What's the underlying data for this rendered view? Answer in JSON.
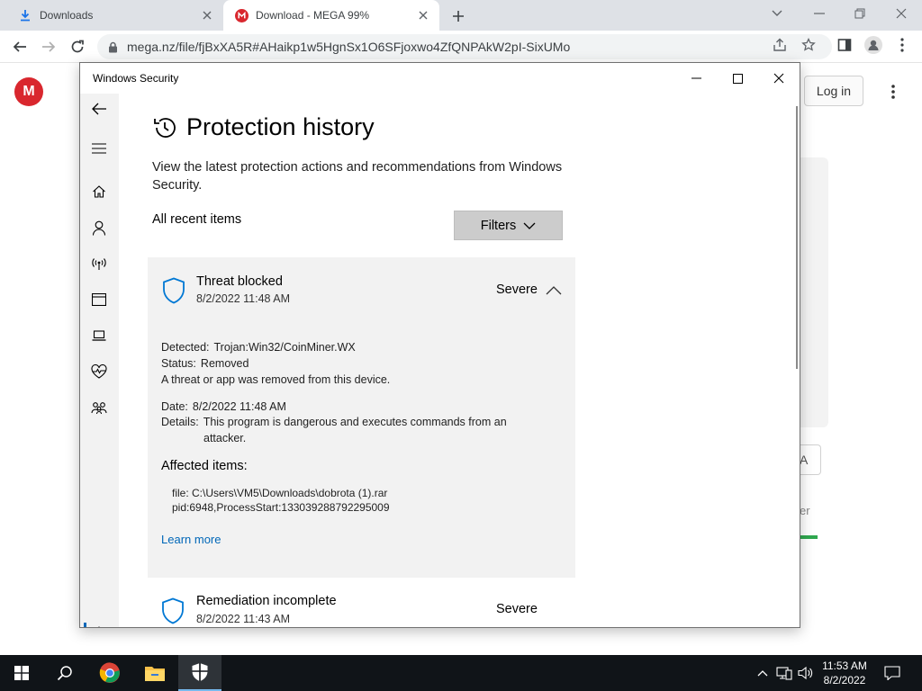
{
  "browser": {
    "tabs": [
      {
        "title": "Downloads",
        "icon": "download-icon"
      },
      {
        "title": "Download - MEGA 99%",
        "icon": "mega-icon"
      }
    ],
    "url": "mega.nz/file/fjBxXA5R#AHaikp1w5HgnSx1O6SFjoxwo4ZfQNPAkW2pI-SixUMo"
  },
  "mega_page": {
    "logo_letter": "M",
    "login_label": "Log in",
    "partial_box_text": "A",
    "partial_text": "er"
  },
  "security_window": {
    "title": "Windows Security",
    "page_title": "Protection history",
    "description": "View the latest protection actions and recommendations from Windows Security.",
    "section_label": "All recent items",
    "filters_label": "Filters",
    "items": [
      {
        "title": "Threat blocked",
        "date": "8/2/2022 11:48 AM",
        "severity": "Severe",
        "detected_label": "Detected:",
        "detected_value": "Trojan:Win32/CoinMiner.WX",
        "status_label": "Status:",
        "status_value": "Removed",
        "status_note": "A threat or app was removed from this device.",
        "date_label": "Date:",
        "date_value": "8/2/2022 11:48 AM",
        "details_label": "Details:",
        "details_line1": "This program is dangerous and executes commands from an",
        "details_line2": "attacker.",
        "affected_heading": "Affected items:",
        "affected_line1": "file: C:\\Users\\VM5\\Downloads\\dobrota (1).rar",
        "affected_line2": "pid:6948,ProcessStart:133039288792295009",
        "learn_more": "Learn more"
      },
      {
        "title": "Remediation incomplete",
        "date": "8/2/2022 11:43 AM",
        "severity": "Severe"
      }
    ]
  },
  "taskbar": {
    "time": "11:53 AM",
    "date": "8/2/2022"
  },
  "colors": {
    "accent": "#0067b8",
    "mega_red": "#d9272e",
    "taskbar": "#101418"
  }
}
